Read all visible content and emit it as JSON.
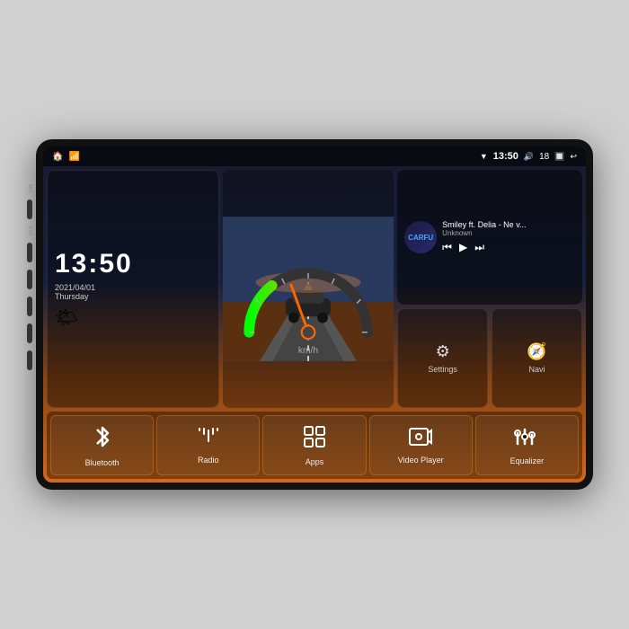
{
  "device": {
    "background": "#111"
  },
  "statusBar": {
    "time": "13:50",
    "volume": "18",
    "leftIcons": [
      "🏠",
      "📶"
    ]
  },
  "clock": {
    "time": "13:50",
    "date": "2021/04/01",
    "day": "Thursday"
  },
  "music": {
    "logo": "CARFU",
    "title": "Smiley ft. Delia - Ne v...",
    "artist": "Unknown",
    "controls": [
      "⏮",
      "▶",
      "⏭"
    ]
  },
  "quickButtons": [
    {
      "id": "settings",
      "label": "Settings",
      "icon": "⚙"
    },
    {
      "id": "navi",
      "label": "Navi",
      "icon": "▲"
    }
  ],
  "apps": [
    {
      "id": "bluetooth",
      "label": "Bluetooth",
      "icon": "bluetooth"
    },
    {
      "id": "radio",
      "label": "Radio",
      "icon": "radio"
    },
    {
      "id": "apps",
      "label": "Apps",
      "icon": "apps"
    },
    {
      "id": "video",
      "label": "Video Player",
      "icon": "video"
    },
    {
      "id": "equalizer",
      "label": "Equalizer",
      "icon": "equalizer"
    }
  ],
  "labels": {
    "mic": "MIC",
    "rst": "RST"
  }
}
